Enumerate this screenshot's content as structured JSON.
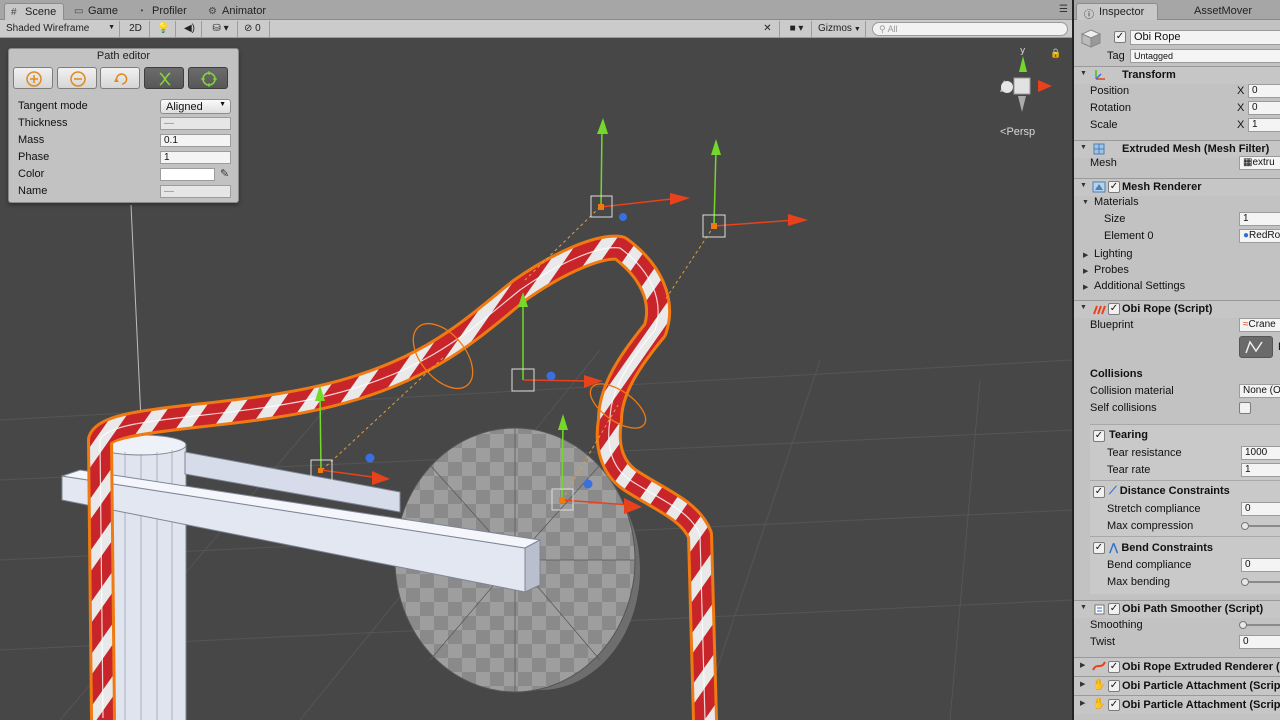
{
  "scene_tabs": [
    {
      "label": "Scene",
      "icon": "scene-icon"
    },
    {
      "label": "Game",
      "icon": "game-icon"
    },
    {
      "label": "Profiler",
      "icon": "profiler-icon"
    },
    {
      "label": "Animator",
      "icon": "animator-icon"
    }
  ],
  "toolbar": {
    "shading_mode": "Shaded Wireframe",
    "mode_2d": "2D",
    "hidden_count": "0",
    "gizmos": "Gizmos",
    "search_placeholder": "All"
  },
  "viewport": {
    "projection": "Persp",
    "gizmo_axis": "y"
  },
  "path_editor": {
    "title": "Path editor",
    "buttons": [
      {
        "name": "add-point",
        "icon": "add-circle-icon",
        "active": false
      },
      {
        "name": "remove-point",
        "icon": "remove-circle-icon",
        "active": false
      },
      {
        "name": "loop",
        "icon": "loop-icon",
        "active": false
      },
      {
        "name": "mirror",
        "icon": "orientation-icon",
        "active": true
      },
      {
        "name": "select",
        "icon": "target-icon",
        "active": true
      }
    ],
    "fields": {
      "tangent_mode": {
        "label": "Tangent mode",
        "value": "Aligned"
      },
      "thickness": {
        "label": "Thickness",
        "value": "—"
      },
      "mass": {
        "label": "Mass",
        "value": "0.1"
      },
      "phase": {
        "label": "Phase",
        "value": "1"
      },
      "color": {
        "label": "Color",
        "value": "#ffffff"
      },
      "name": {
        "label": "Name",
        "value": "—"
      }
    }
  },
  "inspector": {
    "tabs": [
      "Inspector",
      "AssetMover"
    ],
    "object_name": "Obi Rope",
    "tag_label": "Tag",
    "tag_value": "Untagged",
    "transform": {
      "title": "Transform",
      "position": "Position",
      "rotation": "Rotation",
      "scale": "Scale",
      "axis_x": "X",
      "pos_x": "0",
      "rot_x": "0",
      "scale_x": "1"
    },
    "mesh_filter": {
      "title": "Extruded Mesh (Mesh Filter)",
      "mesh_label": "Mesh",
      "mesh_value": "extru"
    },
    "mesh_renderer": {
      "title": "Mesh Renderer",
      "materials": "Materials",
      "size_label": "Size",
      "size_value": "1",
      "element0_label": "Element 0",
      "element0_value": "RedRo",
      "lighting": "Lighting",
      "probes": "Probes",
      "additional": "Additional Settings"
    },
    "obi_rope": {
      "title": "Obi Rope (Script)",
      "blueprint_label": "Blueprint",
      "blueprint_value": "Crane",
      "edit_label": "E"
    },
    "collisions": {
      "title": "Collisions",
      "material_label": "Collision material",
      "material_value": "None (O",
      "self_label": "Self collisions"
    },
    "tearing": {
      "title": "Tearing",
      "resistance_label": "Tear resistance",
      "resistance_value": "1000",
      "rate_label": "Tear rate",
      "rate_value": "1"
    },
    "distance": {
      "title": "Distance Constraints",
      "stretch_label": "Stretch compliance",
      "stretch_value": "0",
      "maxc_label": "Max compression"
    },
    "bend": {
      "title": "Bend Constraints",
      "compliance_label": "Bend compliance",
      "compliance_value": "0",
      "maxb_label": "Max bending"
    },
    "smoother": {
      "title": "Obi Path Smoother (Script)",
      "smoothing_label": "Smoothing",
      "twist_label": "Twist",
      "twist_value": "0"
    },
    "components": [
      "Obi Rope Extruded Renderer (",
      "Obi Particle Attachment (Scrip",
      "Obi Particle Attachment (Scrip"
    ],
    "colors": {
      "accent": "#2f6fd0",
      "rope_red": "#c8252b",
      "selection": "#f07a12",
      "gizmo_x": "#e8421c",
      "gizmo_y": "#74d82a",
      "gizmo_z": "#3a6fe0"
    }
  }
}
